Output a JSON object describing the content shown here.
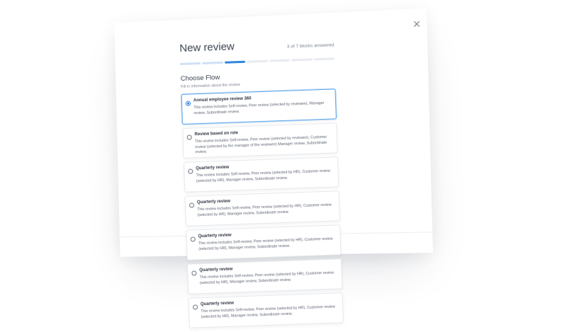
{
  "modal": {
    "title": "New review",
    "answered": "3 of 7 blocks answered",
    "progress_total": 7,
    "progress_done": 3,
    "close_icon": "close-icon"
  },
  "section": {
    "title": "Choose Flow",
    "subtitle": "Fill in information about the review"
  },
  "options": [
    {
      "title": "Annual employee review 360",
      "desc": "This review includes Self-review, Peer review (selected by reviewee), Manager review, Subordinate review.",
      "selected": true
    },
    {
      "title": "Review based on role",
      "desc": "This review includes Self-review, Peer review (selected by reviewee), Customer review (selected by the manager of the reviewee) Manager review, Subordinate review.",
      "selected": false
    },
    {
      "title": "Quarterly review",
      "desc": "This review includes Self-review, Peer review (selected by HR), Customer review (selected by HR), Manager review, Subordinate review.",
      "selected": false
    },
    {
      "title": "Quarterly review",
      "desc": "This review includes Self-review, Peer review (selected by HR), Customer review (selected by HR), Manager review, Subordinate review.",
      "selected": false
    },
    {
      "title": "Quarterly review",
      "desc": "This review includes Self-review, Peer review (selected by HR), Customer review (selected by HR), Manager review, Subordinate review.",
      "selected": false
    },
    {
      "title": "Quarterly review",
      "desc": "This review includes Self-review, Peer review (selected by HR), Customer review (selected by HR), Manager review, Subordinate review.",
      "selected": false
    },
    {
      "title": "Quarterly review",
      "desc": "This review includes Self-review, Peer review (selected by HR), Customer review (selected by HR), Manager review, Subordinate review.",
      "selected": false
    }
  ],
  "colors": {
    "accent": "#2e86de",
    "progress_done": "#cfe0f5",
    "progress_empty": "#e7eaef"
  }
}
